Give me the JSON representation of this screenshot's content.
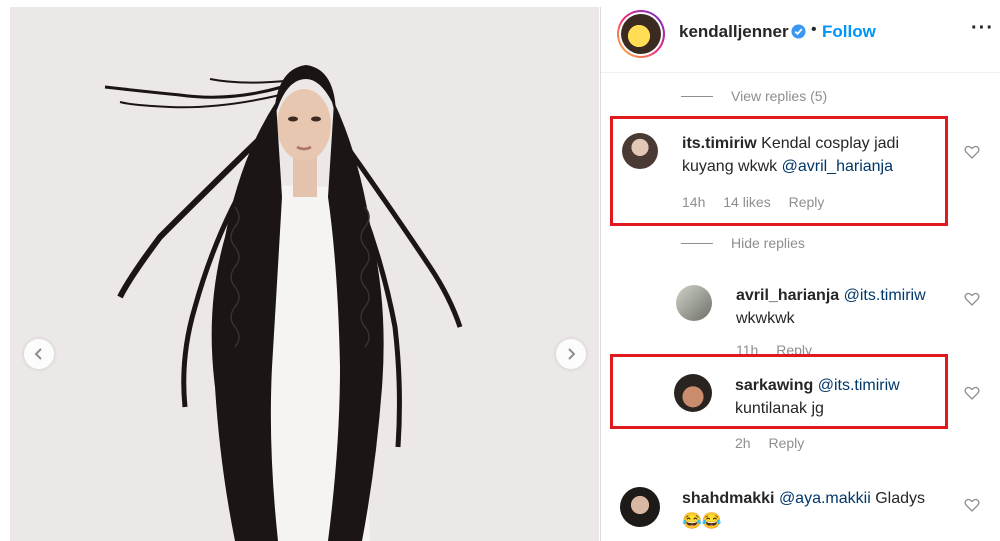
{
  "header": {
    "username": "kendalljenner",
    "dot": "•",
    "follow_label": "Follow",
    "more_label": "···"
  },
  "comments": {
    "view_replies": "View replies (5)",
    "hide_replies": "Hide replies",
    "c1": {
      "user": "its.timiriw",
      "text_before": "Kendal cosplay jadi kuyang wkwk ",
      "mention": "@avril_harianja",
      "time": "14h",
      "likes": "14 likes",
      "reply": "Reply"
    },
    "r1": {
      "user": "avril_harianja",
      "mention": "@its.timiriw",
      "text_after": "wkwkwk",
      "time": "11h",
      "reply": "Reply"
    },
    "r2": {
      "user": "sarkawing",
      "mention": "@its.timiriw",
      "text_after": "kuntilanak jg",
      "time": "2h",
      "reply": "Reply"
    },
    "c2": {
      "user": "shahdmakki",
      "mention": "@aya.makkii",
      "text_after": " Gladys",
      "emoji": "😂😂"
    }
  },
  "colors": {
    "accent": "#0095f6",
    "highlight": "#e0191f",
    "mention": "#00376b",
    "muted": "#8e8e8e"
  },
  "icons": [
    "chevron-left-icon",
    "chevron-right-icon",
    "verified-badge-icon",
    "more-icon",
    "heart-icon"
  ]
}
